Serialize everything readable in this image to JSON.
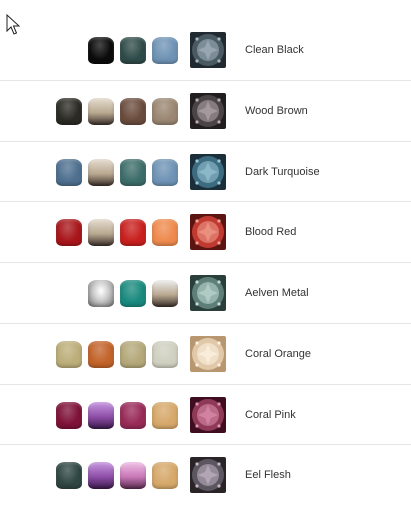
{
  "items": [
    {
      "name": "Clean Black",
      "swatches": [
        "#0b0b0b",
        "#2f4b49",
        "#6f93b5"
      ],
      "thumb": [
        "#4a5a63",
        "#a8b8c2",
        "#202a30"
      ]
    },
    {
      "name": "Wood Brown",
      "swatches": [
        "#2b2a24",
        "#e6ddd0",
        "#6a4c3d",
        "#9a8672"
      ],
      "thumb": [
        "#4a4446",
        "#b8acae",
        "#221e20"
      ]
    },
    {
      "name": "Dark Turquoise",
      "swatches": [
        "#4e6f8f",
        "#e6ddd0",
        "#3d6d6a",
        "#6f93b5"
      ],
      "thumb": [
        "#3d6c80",
        "#9dc8d8",
        "#1a2f3a"
      ]
    },
    {
      "name": "Blood Red",
      "swatches": [
        "#a8161a",
        "#e6ddd0",
        "#c8201e",
        "#ee8a4e"
      ],
      "thumb": [
        "#c03a32",
        "#f2a290",
        "#5c1410"
      ]
    },
    {
      "name": "Aelven Metal",
      "swatches": [
        "#e8e8e8",
        "#1a8a7e",
        "#eeeeee"
      ],
      "thumb": [
        "#5e7e78",
        "#c2dcd6",
        "#2a3e3a"
      ]
    },
    {
      "name": "Coral Orange",
      "swatches": [
        "#bcae7a",
        "#c2632a",
        "#b4a87a",
        "#cfd0c0"
      ],
      "thumb": [
        "#e0c8a8",
        "#fff4e4",
        "#b89670"
      ]
    },
    {
      "name": "Coral Pink",
      "swatches": [
        "#7e1238",
        "#b07ad0",
        "#982a58",
        "#d6a86a"
      ],
      "thumb": [
        "#8e3a56",
        "#e092b0",
        "#3e0e20"
      ]
    },
    {
      "name": "Eel Flesh",
      "swatches": [
        "#2f4642",
        "#b07ad0",
        "#e0a6d6",
        "#d6a86a"
      ],
      "thumb": [
        "#5c5660",
        "#c4b8c6",
        "#2a2428"
      ]
    }
  ]
}
